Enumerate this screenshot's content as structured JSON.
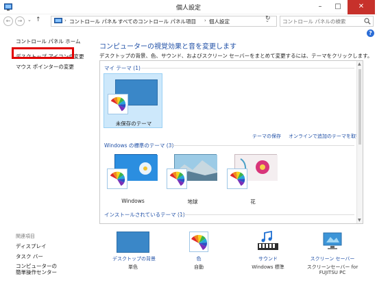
{
  "window": {
    "title": "個人設定",
    "minimize": "–",
    "maximize": "□",
    "close": "✕"
  },
  "nav": {
    "back": "←",
    "forward": "→",
    "dropdown": "⌄",
    "up": "↑",
    "breadcrumb": [
      "コントロール パネル",
      "すべてのコントロール パネル項目",
      "個人設定"
    ],
    "separator": "›",
    "refresh": "↻",
    "search_placeholder": "コントロール パネルの検索"
  },
  "help": "?",
  "sidebar": {
    "home": "コントロール パネル ホーム",
    "desktop_icons": "デスクトップ アイコンの変更",
    "mouse_pointer": "マウス ポインターの変更",
    "related_heading": "関連項目",
    "related": [
      "ディスプレイ",
      "タスク バー",
      "コンピューターの",
      "簡単操作センター"
    ]
  },
  "main": {
    "title": "コンピューターの視覚効果と音を変更します",
    "description": "デスクトップの背景、色、サウンド、およびスクリーン セーバーをまとめて変更するには、テーマをクリックします。",
    "groups": {
      "my_themes": "マイ テーマ (1)",
      "windows_themes": "Windows の標準のテーマ (3)",
      "installed_themes": "インストールされているテーマ (1)"
    },
    "my_theme_label": "未保存のテーマ",
    "save_theme": "テーマの保存",
    "get_more_online": "オンラインで追加のテーマを取得",
    "windows_themes": [
      "Windows",
      "地球",
      "花"
    ]
  },
  "bottom": {
    "background": {
      "label": "デスクトップの背景",
      "value": "単色"
    },
    "color": {
      "label": "色",
      "value": "自動"
    },
    "sound": {
      "label": "サウンド",
      "value": "Windows 標準"
    },
    "screensaver": {
      "label": "スクリーン セーバー",
      "value1": "スクリーンセーバー for",
      "value2": "FUJITSU PC"
    }
  },
  "colors": {
    "accent_blue": "#1f4fa6",
    "close_red": "#c7312b",
    "selection": "#cde8fb",
    "highlight_box": "#e00000"
  }
}
